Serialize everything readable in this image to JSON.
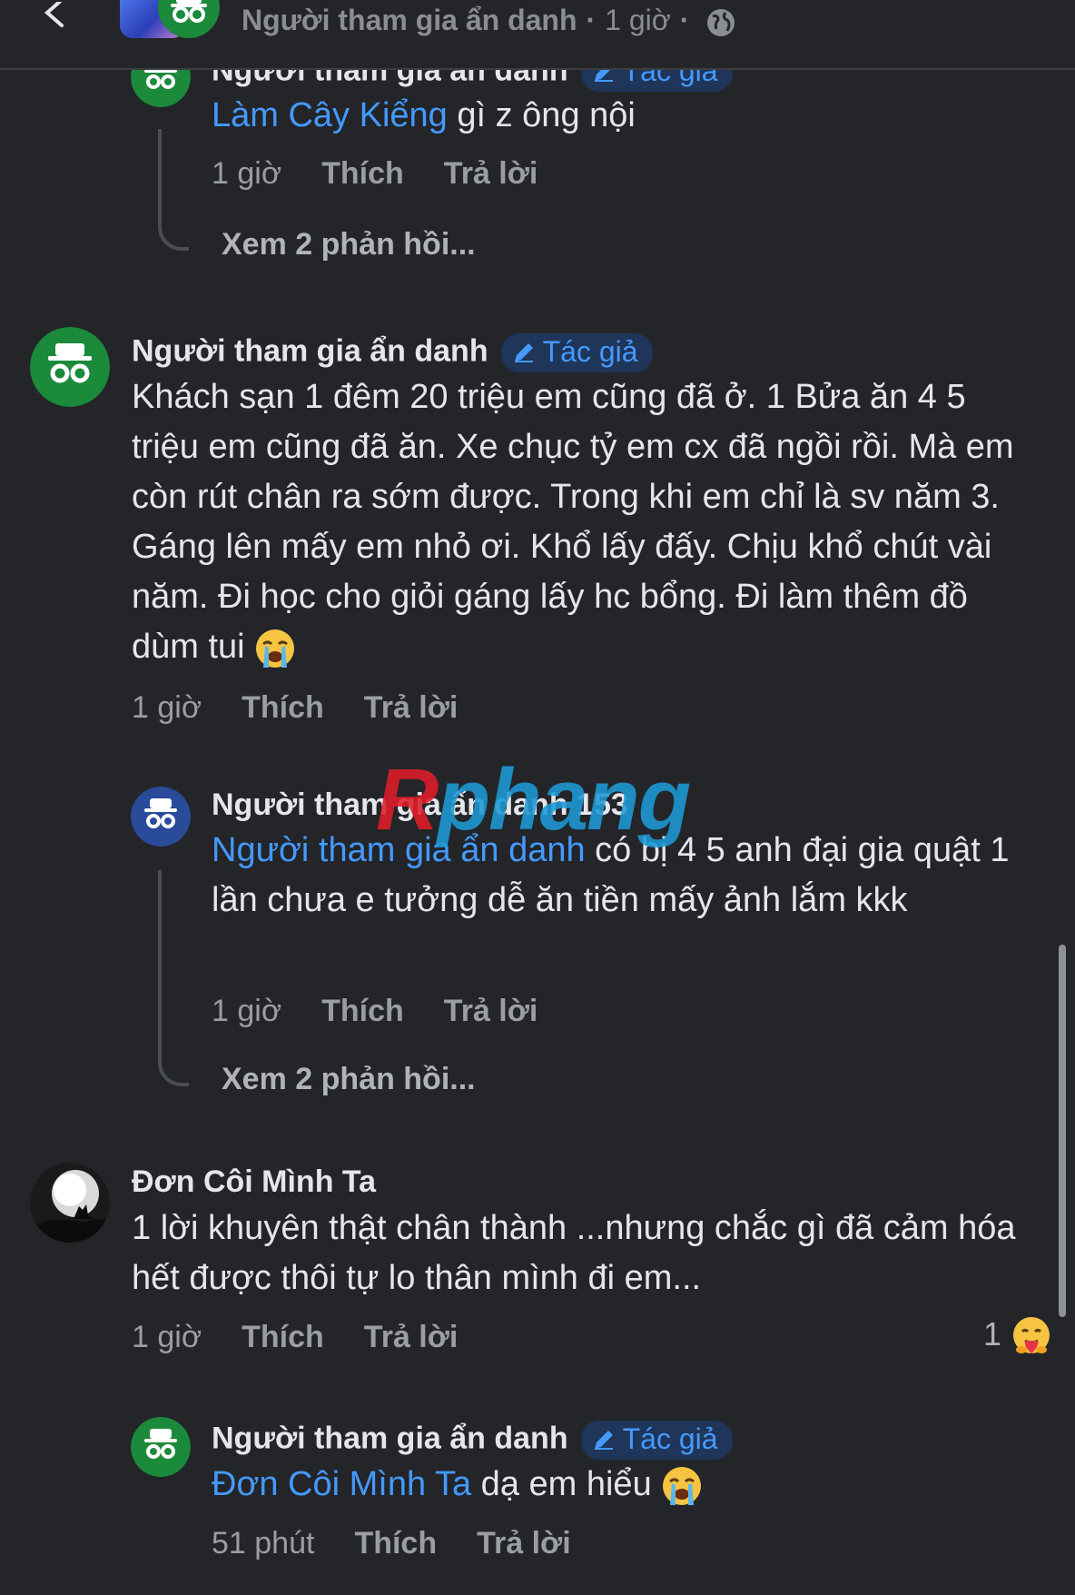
{
  "header": {
    "title": "Người tham gia ẩn danh",
    "time": "1 giờ",
    "separator": "·",
    "icons": [
      "back-icon",
      "incognito-icon",
      "globe-icon",
      "more-icon"
    ]
  },
  "labels": {
    "author_badge": "Tác giả",
    "like": "Thích",
    "reply": "Trả lời"
  },
  "comments": [
    {
      "name": "Người tham gia ẩn danh",
      "is_author": true,
      "mention": "Làm Cây Kiểng",
      "text": " gì z ông nội",
      "time": "1 giờ",
      "view_replies": "Xem 2 phản hồi..."
    },
    {
      "name": "Người tham gia ẩn danh",
      "is_author": true,
      "text": "Khách sạn 1 đêm 20 triệu em cũng đã ở. 1 Bửa ăn 4 5 triệu em cũng đã ăn. Xe chục tỷ em cx đã ngồi rồi. Mà em còn rút chân ra sớm được. Trong khi em chỉ là sv năm 3. Gáng lên mấy em nhỏ ơi. Khổ lấy đấy. Chịu khổ chút vài năm. Đi học cho giỏi gáng lấy hc bổng. Đi làm thêm đồ dùm tui",
      "time": "1 giờ"
    },
    {
      "name": "Người tham gia ẩn danh 153",
      "mention": "Người tham gia ẩn danh",
      "text": " có bị 4 5 anh đại gia quật 1 lần chưa e tưởng dễ ăn tiền mấy ảnh lắm kkk",
      "time": "1 giờ",
      "view_replies": "Xem 2 phản hồi..."
    },
    {
      "name": "Đơn Côi Mình Ta",
      "text": "1 lời khuyên thật chân thành ...nhưng chắc gì đã cảm hóa hết được thôi tự lo thân mình đi em...",
      "time": "1 giờ",
      "reaction_count": "1"
    },
    {
      "name": "Người tham gia ẩn danh",
      "is_author": true,
      "mention": "Đơn Côi Mình Ta",
      "text": " dạ em hiểu",
      "time": "51 phút"
    }
  ],
  "watermark": {
    "part1": "R",
    "part2": "phang"
  },
  "colors": {
    "background": "#232529",
    "text": "#e4e6eb",
    "link": "#4599ff",
    "badge_bg": "#1f3559",
    "muted": "#9a9da2",
    "avatar_green": "#1b8a3b"
  }
}
